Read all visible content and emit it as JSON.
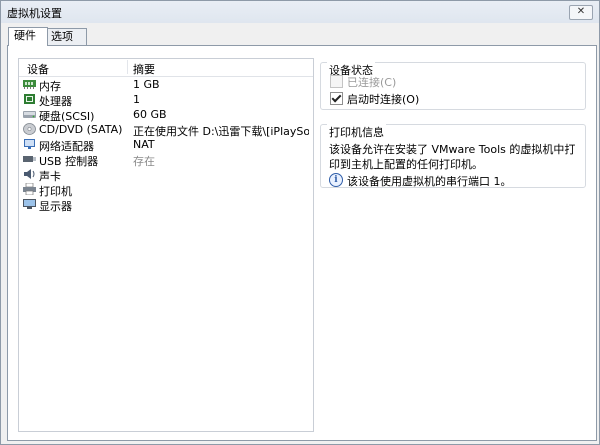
{
  "window": {
    "title": "虚拟机设置",
    "close_symbol": "✕"
  },
  "tabs": [
    {
      "label": "硬件",
      "active": true
    },
    {
      "label": "选项",
      "active": false
    }
  ],
  "device_list": {
    "col_device": "设备",
    "col_summary": "摘要",
    "rows": [
      {
        "label": "内存",
        "summary": "1 GB",
        "icon": "memory-icon"
      },
      {
        "label": "处理器",
        "summary": "1",
        "icon": "processor-icon"
      },
      {
        "label": "硬盘(SCSI)",
        "summary": "60 GB",
        "icon": "hard-disk-icon"
      },
      {
        "label": "CD/DVD (SATA)",
        "summary": "正在使用文件 D:\\迅雷下载\\[iPlaySof...",
        "icon": "cd-dvd-icon"
      },
      {
        "label": "网络适配器",
        "summary": "NAT",
        "icon": "network-adapter-icon"
      },
      {
        "label": "USB 控制器",
        "summary": "存在",
        "icon": "usb-controller-icon"
      },
      {
        "label": "声卡",
        "summary": "",
        "icon": "sound-card-icon"
      },
      {
        "label": "打印机",
        "summary": "",
        "icon": "printer-icon"
      },
      {
        "label": "显示器",
        "summary": "",
        "icon": "display-icon"
      }
    ]
  },
  "device_status": {
    "title": "设备状态",
    "connected_label": "已连接(C)",
    "connected_checked": false,
    "connected_enabled": false,
    "connect_on_power_label": "启动时连接(O)",
    "connect_on_power_checked": true
  },
  "printer_info": {
    "title": "打印机信息",
    "description": "该设备允许在安装了 VMware Tools 的虚拟机中打印到主机上配置的任何打印机。",
    "info_icon_symbol": "i",
    "port_note": "该设备使用虚拟机的串行端口 1。"
  },
  "colors": {
    "border": "#8e9aa8",
    "accent": "#2f5da8",
    "disabled_text": "#9a9a9a"
  }
}
